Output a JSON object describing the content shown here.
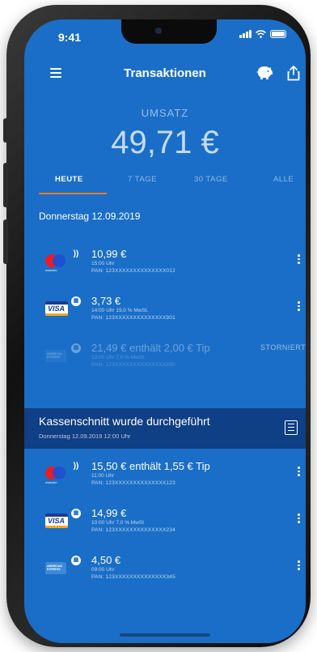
{
  "status_bar": {
    "time": "9:41"
  },
  "nav": {
    "title": "Transaktionen"
  },
  "summary": {
    "label": "UMSATZ",
    "value": "49,71 €"
  },
  "tabs": [
    {
      "label": "HEUTE",
      "active": true
    },
    {
      "label": "7 TAGE",
      "active": false
    },
    {
      "label": "30 TAGE",
      "active": false
    },
    {
      "label": "ALLE",
      "active": false
    }
  ],
  "section_date": "Donnerstag 12.09.2019",
  "transactions_before": [
    {
      "card": "mastercard-contactless",
      "card_text": "maestro",
      "amount": "10,99 €",
      "sub": "15:00 Uhr",
      "pan": "PAN: 123XXXXXXXXXXXXXX012"
    },
    {
      "card": "visa-chip",
      "card_text": "VISA",
      "amount": "3,73 €",
      "sub": "14:00 Uhr   19,0 % MwSt.",
      "pan": "PAN: 123XXXXXXXXXXXXXX901"
    },
    {
      "card": "amex-chip",
      "card_text": "AMERICAN EXPRESS",
      "amount": "21,49 €  enthält 2,00 € Tip",
      "sub": "13:00 Uhr   7,0 % MwSt.",
      "pan": "PAN: 123XXXXXXXXXXXXXX890",
      "status": "STORNIERT"
    }
  ],
  "kassenschnitt": {
    "title": "Kassenschnitt wurde durchgeführt",
    "sub": "Donnerstag 12.09.2019 12:00 Uhr"
  },
  "transactions_after": [
    {
      "card": "mastercard-contactless",
      "card_text": "maestro",
      "amount": "15,50 €  enthält 1,55 € Tip",
      "sub": "11:00 Uhr",
      "pan": "PAN: 123XXXXXXXXXXXXXX123"
    },
    {
      "card": "visa-chip",
      "card_text": "VISA",
      "amount": "14,99 €",
      "sub": "10:00 Uhr   7,0 % MwSt",
      "pan": "PAN: 123XXXXXXXXXXXXXX234"
    },
    {
      "card": "amex-chip",
      "card_text": "AMERICAN EXPRESS",
      "amount": "4,50 €",
      "sub": "09:00 Uhr",
      "pan": "PAN: 123XXXXXXXXXXXXXX345"
    }
  ],
  "colors": {
    "background": "#1a6ec7",
    "banner": "#0f3f84",
    "tab_accent": "#f07a24"
  }
}
